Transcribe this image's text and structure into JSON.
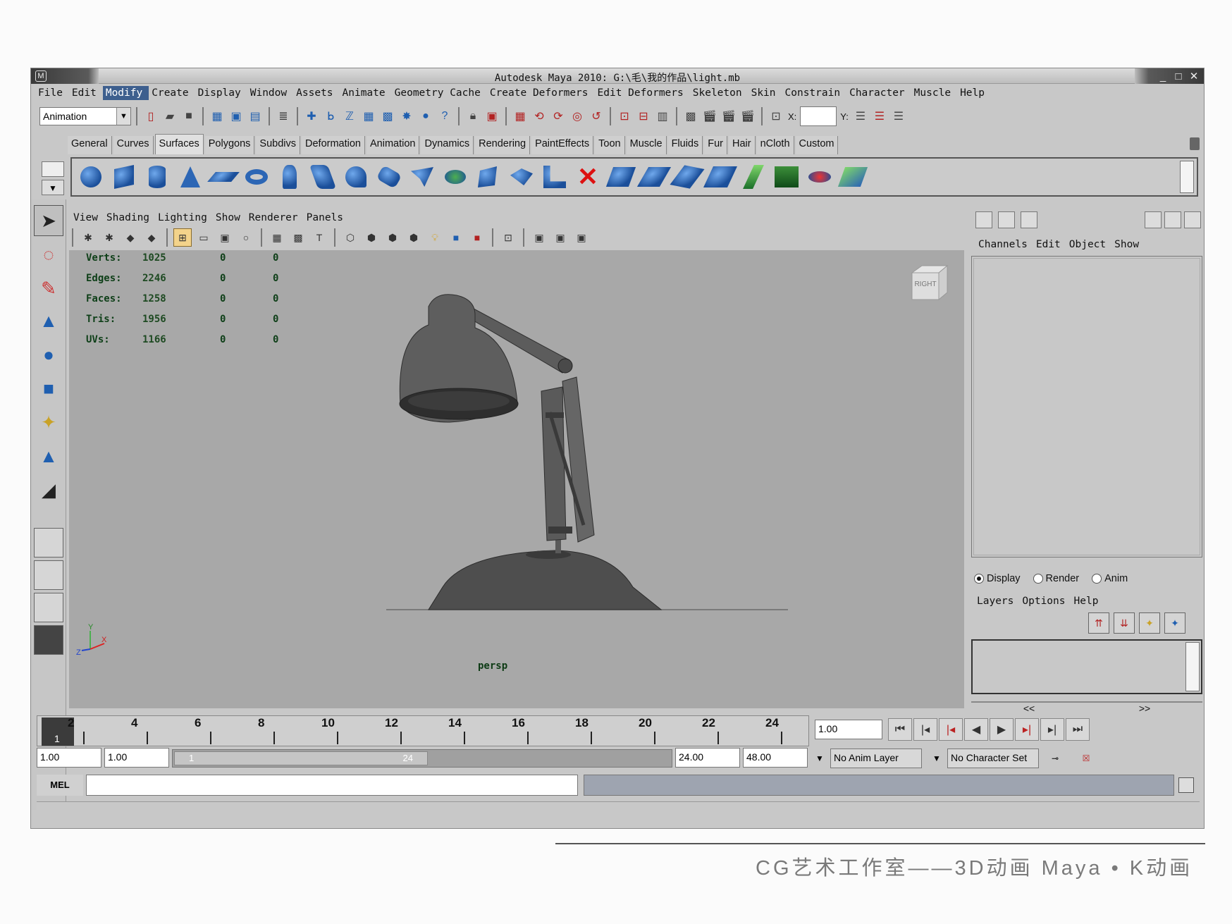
{
  "window": {
    "title": "Autodesk Maya 2010: G:\\毛\\我的作品\\light.mb"
  },
  "menubar": [
    "File",
    "Edit",
    "Modify",
    "Create",
    "Display",
    "Window",
    "Assets",
    "Animate",
    "Geometry Cache",
    "Create Deformers",
    "Edit Deformers",
    "Skeleton",
    "Skin",
    "Constrain",
    "Character",
    "Muscle",
    "Help"
  ],
  "menubar_active": "Modify",
  "statusline": {
    "mode": "Animation",
    "x_label": "X:",
    "y_label": "Y:"
  },
  "shelf_tabs": [
    "General",
    "Curves",
    "Surfaces",
    "Polygons",
    "Subdivs",
    "Deformation",
    "Animation",
    "Dynamics",
    "Rendering",
    "PaintEffects",
    "Toon",
    "Muscle",
    "Fluids",
    "Fur",
    "Hair",
    "nCloth",
    "Custom"
  ],
  "shelf_active": "Surfaces",
  "panel_menu": [
    "View",
    "Shading",
    "Lighting",
    "Show",
    "Renderer",
    "Panels"
  ],
  "hud": [
    {
      "label": "Verts:",
      "v1": "1025",
      "v2": "0",
      "v3": "0"
    },
    {
      "label": "Edges:",
      "v1": "2246",
      "v2": "0",
      "v3": "0"
    },
    {
      "label": "Faces:",
      "v1": "1258",
      "v2": "0",
      "v3": "0"
    },
    {
      "label": "Tris:",
      "v1": "1956",
      "v2": "0",
      "v3": "0"
    },
    {
      "label": "UVs:",
      "v1": "1166",
      "v2": "0",
      "v3": "0"
    }
  ],
  "viewport": {
    "camera": "persp",
    "viewcube": "RIGHT"
  },
  "channel_menu": [
    "Channels",
    "Edit",
    "Object",
    "Show"
  ],
  "layers": {
    "modes": [
      {
        "label": "Display",
        "on": true
      },
      {
        "label": "Render",
        "on": false
      },
      {
        "label": "Anim",
        "on": false
      }
    ],
    "menu": [
      "Layers",
      "Options",
      "Help"
    ],
    "scroll_left": "<<",
    "scroll_right": ">>"
  },
  "timeline": {
    "current_frame": "1",
    "labels": [
      "2",
      "4",
      "6",
      "8",
      "10",
      "12",
      "14",
      "16",
      "18",
      "20",
      "22",
      "24"
    ],
    "current_field": "1.00"
  },
  "range": {
    "start": "1.00",
    "playback_start": "1.00",
    "thumb_start": "1",
    "thumb_end": "24",
    "playback_end": "24.00",
    "end": "48.00",
    "anim_layer": "No Anim Layer",
    "character_set": "No Character Set"
  },
  "cmdline": {
    "label": "MEL"
  },
  "caption": "CG艺术工作室——3D动画  Maya • K动画"
}
